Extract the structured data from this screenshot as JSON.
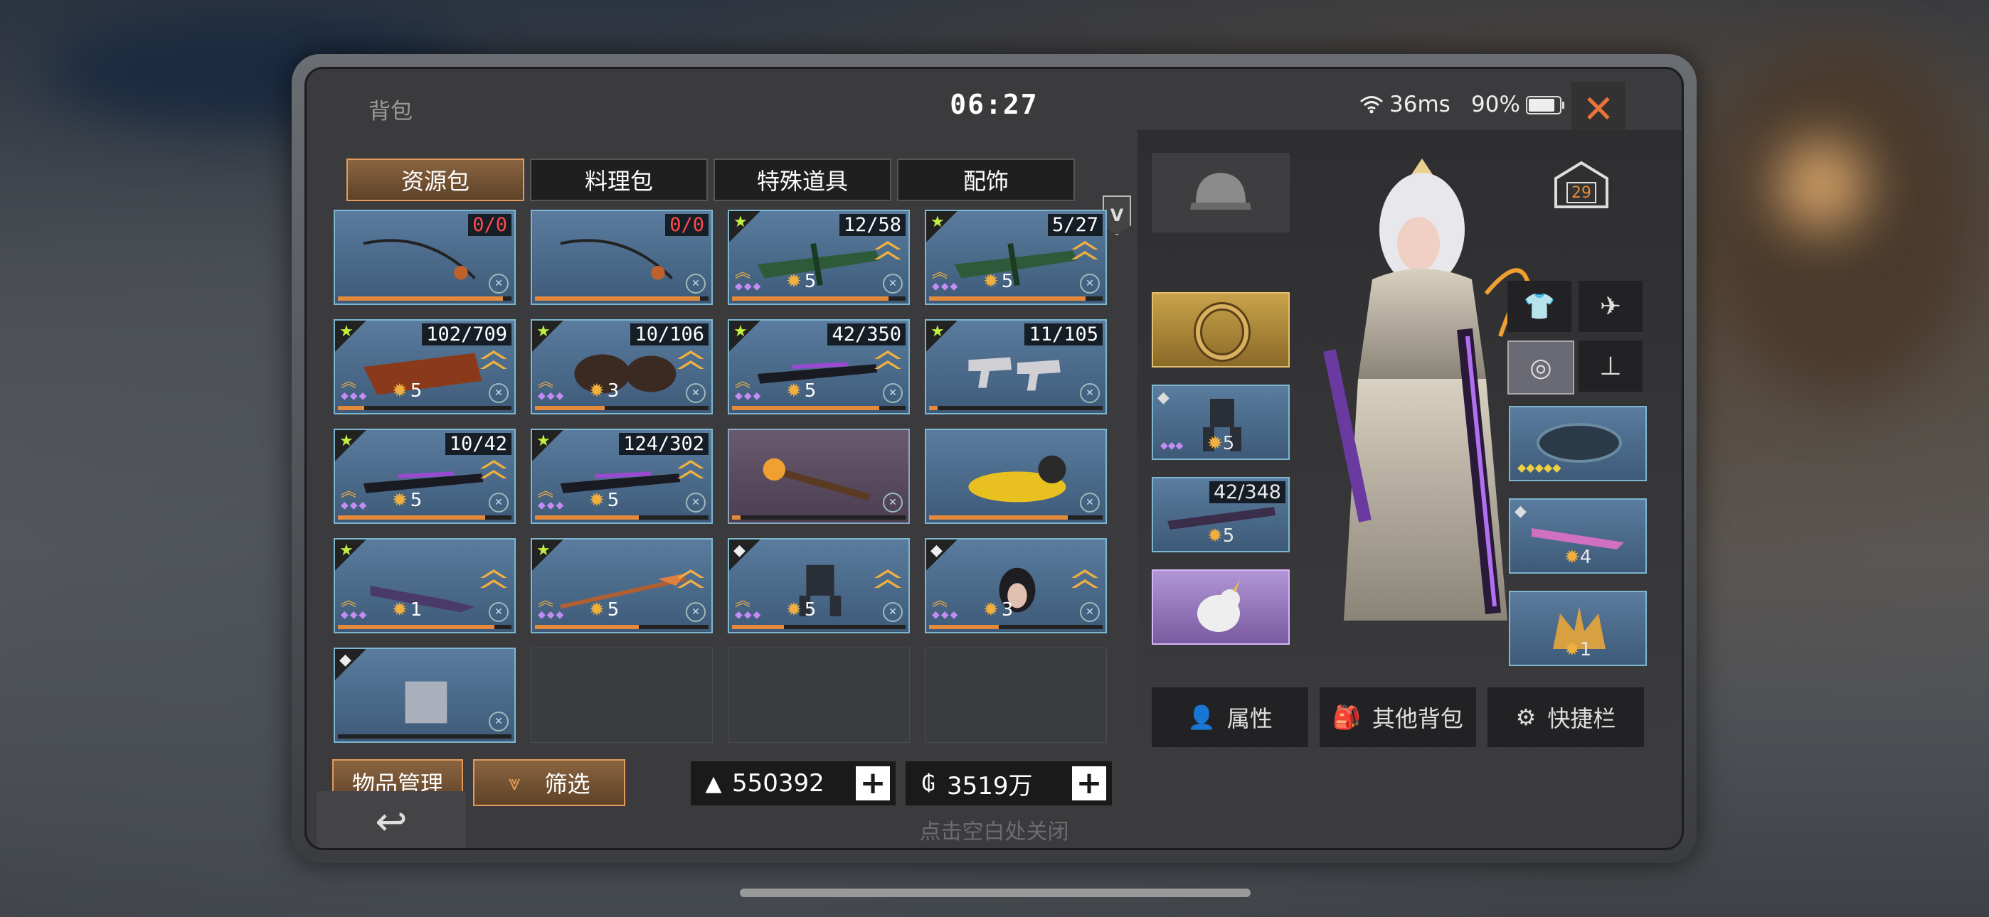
{
  "status": {
    "bag_title": "背包",
    "clock": "06:27",
    "ping": "36ms",
    "battery": "90%",
    "battery_level": 0.9
  },
  "tabs": [
    "资源包",
    "料理包",
    "特殊道具",
    "配饰"
  ],
  "active_tab": 0,
  "version_badge": "V",
  "items": [
    {
      "icon": "fishing-rod-icon",
      "count": "0/0",
      "count_red": true,
      "progress": 0.95
    },
    {
      "icon": "fishing-rod-icon",
      "count": "0/0",
      "count_red": true,
      "progress": 0.95
    },
    {
      "icon": "crossbow-icon",
      "count": "12/58",
      "stars": "5",
      "progress": 0.9,
      "rarity": "★"
    },
    {
      "icon": "crossbow-icon",
      "count": "5/27",
      "stars": "5",
      "progress": 0.9,
      "rarity": "★"
    },
    {
      "icon": "claw-weapon-icon",
      "count": "102/709",
      "stars": "5",
      "progress": 0.15,
      "rarity": "★"
    },
    {
      "icon": "gauntlet-icon",
      "count": "10/106",
      "stars": "3",
      "progress": 0.4,
      "rarity": "★"
    },
    {
      "icon": "rifle-icon",
      "count": "42/350",
      "stars": "5",
      "progress": 0.85,
      "rarity": "★"
    },
    {
      "icon": "dual-pistols-icon",
      "count": "11/105",
      "progress": 0.05,
      "rarity": "★"
    },
    {
      "icon": "rifle-icon",
      "count": "10/42",
      "stars": "5",
      "progress": 0.85,
      "rarity": "★"
    },
    {
      "icon": "rifle-icon",
      "count": "124/302",
      "stars": "5",
      "progress": 0.6,
      "rarity": "★"
    },
    {
      "icon": "torch-icon",
      "progress": 0.05,
      "purple": true
    },
    {
      "icon": "scanner-icon",
      "progress": 0.8
    },
    {
      "icon": "knife-icon",
      "stars": "1",
      "progress": 0.9,
      "rarity": "★"
    },
    {
      "icon": "spear-icon",
      "stars": "5",
      "progress": 0.6,
      "rarity": "★"
    },
    {
      "icon": "mech-icon",
      "stars": "5",
      "progress": 0.3,
      "rarity": "◆"
    },
    {
      "icon": "helmet-icon",
      "stars": "3",
      "progress": 0.4,
      "rarity": "◆"
    },
    {
      "icon": "armor-icon",
      "progress": 0.0,
      "rarity": "◆"
    },
    {
      "empty": true
    },
    {
      "empty": true
    },
    {
      "empty": true
    }
  ],
  "bottom": {
    "manage_label": "物品管理",
    "filter_label": "筛选",
    "currency_a": "550392",
    "currency_b": "3519万"
  },
  "equip": {
    "level": "29",
    "weapon1_stars": "5",
    "weapon2_count": "42/348",
    "weapon2_stars": "5",
    "right_weapon_stars": "4",
    "right_bottom_stars": "1"
  },
  "right_buttons": [
    "属性",
    "其他背包",
    "快捷栏"
  ],
  "hint": "点击空白处关闭",
  "colors": {
    "accent": "#e39a5a",
    "slot_blue": "#5a7c9e",
    "close": "#e8743a"
  }
}
